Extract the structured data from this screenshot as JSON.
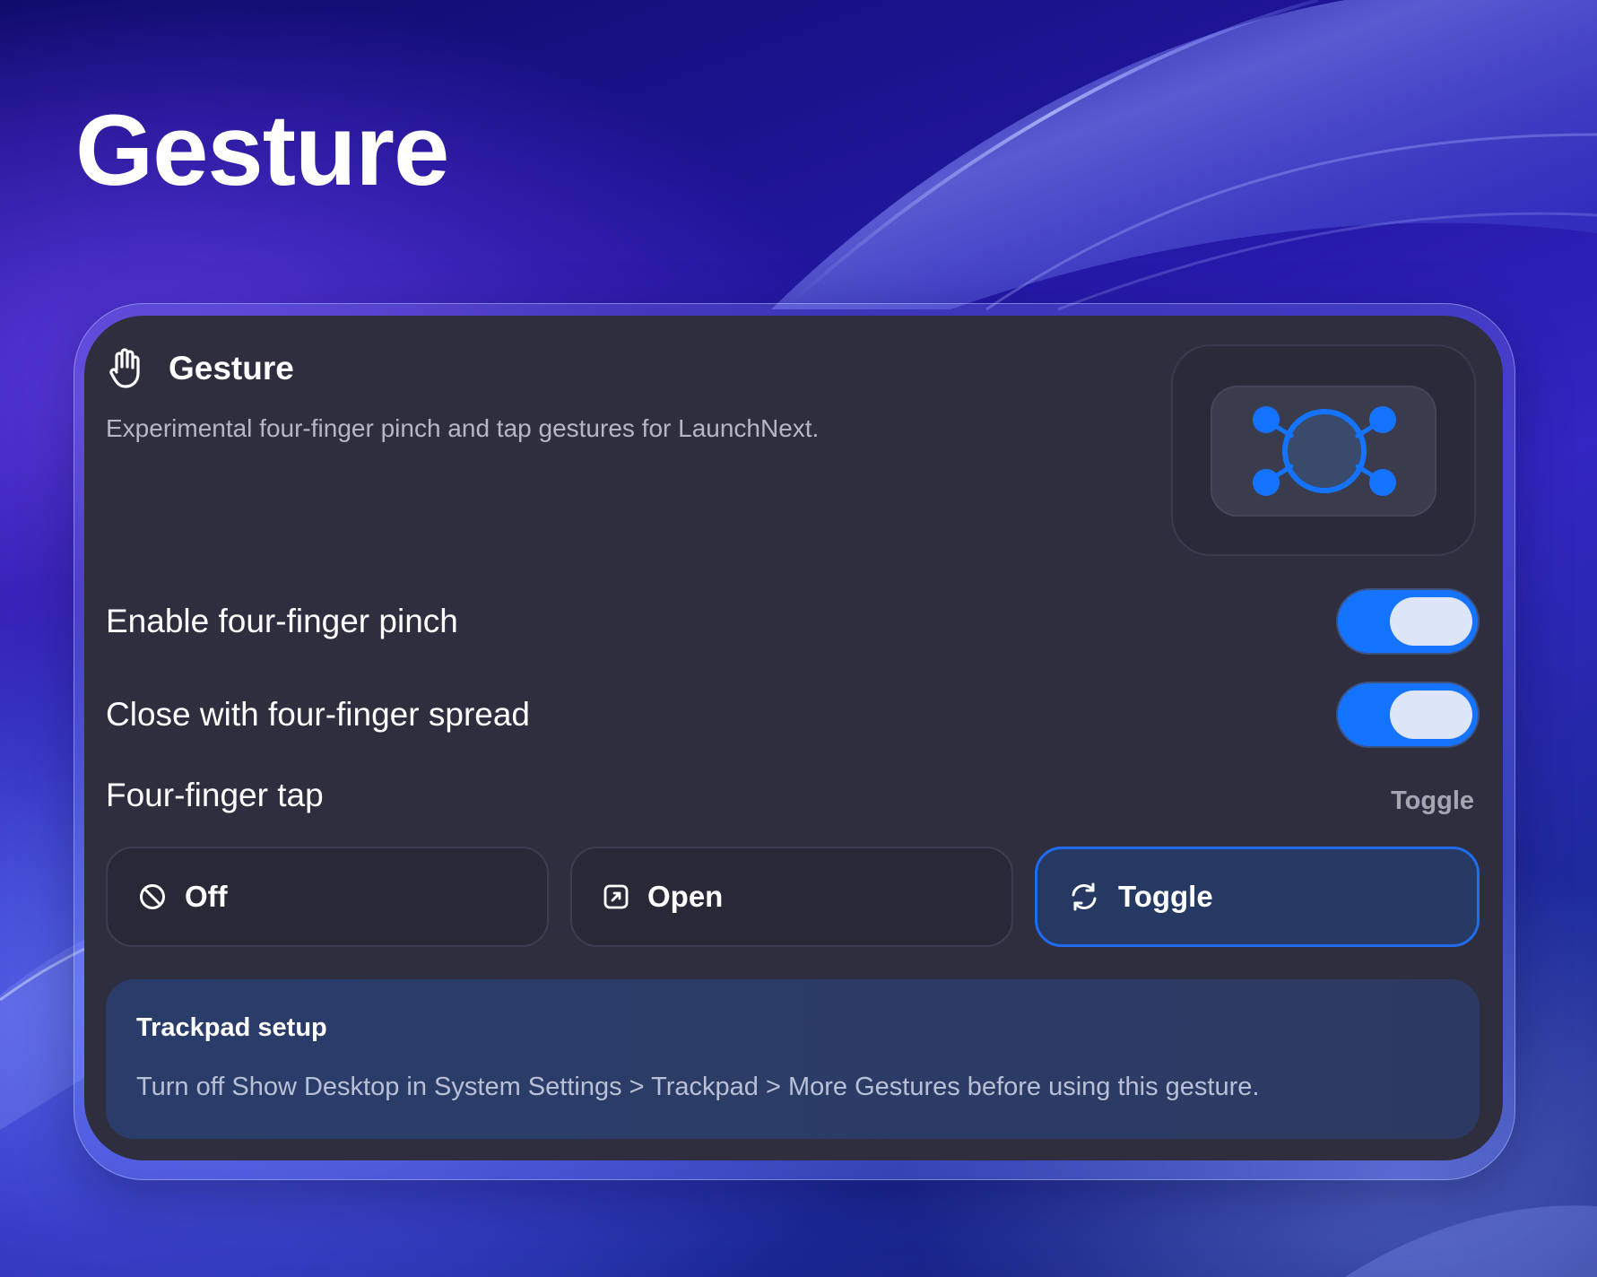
{
  "page": {
    "heading": "Gesture"
  },
  "card": {
    "title": "Gesture",
    "subtitle": "Experimental four-finger pinch and tap gestures for LaunchNext.",
    "icon": "hand-icon",
    "preview_icon": "four-finger-pinch-icon"
  },
  "settings": {
    "enable_pinch": {
      "label": "Enable four-finger pinch",
      "enabled": true
    },
    "close_spread": {
      "label": "Close with four-finger spread",
      "enabled": true
    },
    "tap": {
      "label": "Four-finger tap",
      "value": "Toggle",
      "options": [
        {
          "label": "Off",
          "icon": "prohibited-icon",
          "selected": false
        },
        {
          "label": "Open",
          "icon": "open-arrow-icon",
          "selected": false
        },
        {
          "label": "Toggle",
          "icon": "refresh-icon",
          "selected": true
        }
      ]
    }
  },
  "notice": {
    "title": "Trackpad setup",
    "text": "Turn off Show Desktop in System Settings > Trackpad > More Gestures before using this gesture."
  },
  "colors": {
    "accent": "#1474ff",
    "panel": "#2e2e3f",
    "selected_border": "#1f6cf0",
    "notice_bg": "#2a3d6a"
  }
}
